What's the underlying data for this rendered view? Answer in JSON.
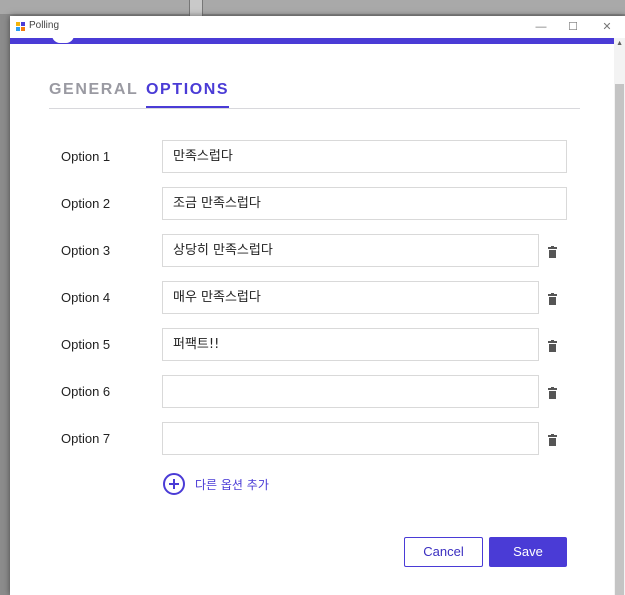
{
  "window": {
    "title": "Polling",
    "controls": {
      "minimize": "—",
      "maximize": "☐",
      "close": "✕"
    },
    "icon_colors": [
      "#f2b40c",
      "#4a3bd6",
      "#2a9df4",
      "#f27a0c"
    ]
  },
  "tabs": [
    {
      "label": "GENERAL",
      "active": false
    },
    {
      "label": "OPTIONS",
      "active": true
    }
  ],
  "options": [
    {
      "label": "Option 1",
      "value": "만족스럽다",
      "deletable": false
    },
    {
      "label": "Option 2",
      "value": "조금 만족스럽다",
      "deletable": false
    },
    {
      "label": "Option 3",
      "value": "상당히 만족스럽다",
      "deletable": true
    },
    {
      "label": "Option 4",
      "value": "매우 만족스럽다",
      "deletable": true
    },
    {
      "label": "Option 5",
      "value": "퍼팩트!!",
      "deletable": true
    },
    {
      "label": "Option 6",
      "value": "",
      "deletable": true
    },
    {
      "label": "Option 7",
      "value": "",
      "deletable": true
    }
  ],
  "add_option": {
    "label": "다른 옵션 추가",
    "icon": "plus-circle-icon"
  },
  "buttons": {
    "cancel": "Cancel",
    "save": "Save"
  },
  "colors": {
    "accent": "#4a3bd6",
    "inactive_tab": "#9a9aa2"
  }
}
